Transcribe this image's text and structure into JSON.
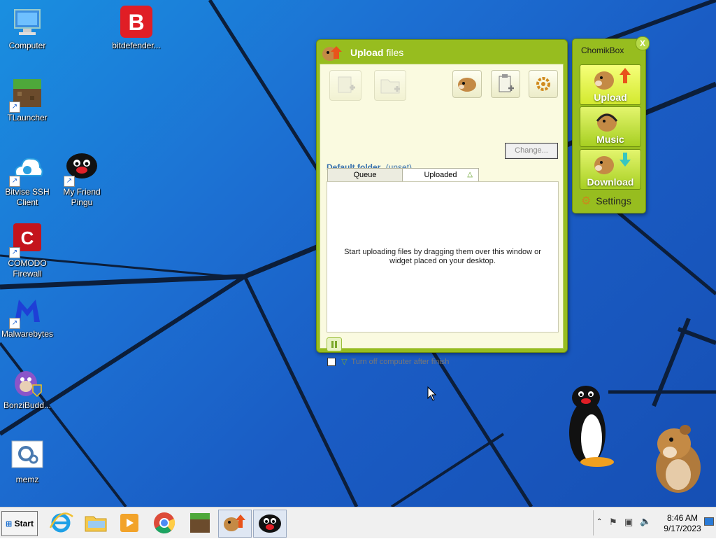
{
  "desktop": {
    "icons": [
      {
        "label": "Computer",
        "icon": "computer-icon"
      },
      {
        "label": "bitdefender...",
        "icon": "bitdefender-icon"
      },
      {
        "label": "TLauncher",
        "icon": "tlauncher-icon"
      },
      {
        "label": "Bitvise SSH Client",
        "icon": "bitvise-icon"
      },
      {
        "label": "My Friend Pingu",
        "icon": "pingu-icon"
      },
      {
        "label": "COMODO Firewall",
        "icon": "comodo-icon"
      },
      {
        "label": "Malwarebytes",
        "icon": "malwarebytes-icon"
      },
      {
        "label": "BonziBudd...",
        "icon": "bonzibuddy-icon"
      },
      {
        "label": "memz",
        "icon": "memz-icon"
      }
    ]
  },
  "upload_window": {
    "title_bold": "Upload",
    "title_rest": "files",
    "default_folder_label": "Default folder",
    "default_folder_value": "(unset)",
    "change_button": "Change...",
    "tabs": [
      {
        "label": "Queue"
      },
      {
        "label": "Uploaded"
      }
    ],
    "empty_message": "Start uploading files by dragging them over this window or widget placed on your desktop.",
    "turn_off_label": "Turn off computer after finish"
  },
  "chomikbox_widget": {
    "title": "ChomikBox",
    "close_label": "X",
    "buttons": [
      {
        "label": "Upload"
      },
      {
        "label": "Music"
      },
      {
        "label": "Download"
      }
    ],
    "settings_label": "Settings"
  },
  "taskbar": {
    "start_label": "Start",
    "items": [
      "internet-explorer-icon",
      "file-explorer-icon",
      "media-player-icon",
      "chrome-icon",
      "minecraft-icon",
      "chomikbox-icon",
      "pingu-icon"
    ],
    "clock_time": "8:46 AM",
    "clock_date": "9/17/2023"
  },
  "colors": {
    "accent_green": "#97bd1f",
    "desktop_blue": "#1a6fd6"
  }
}
